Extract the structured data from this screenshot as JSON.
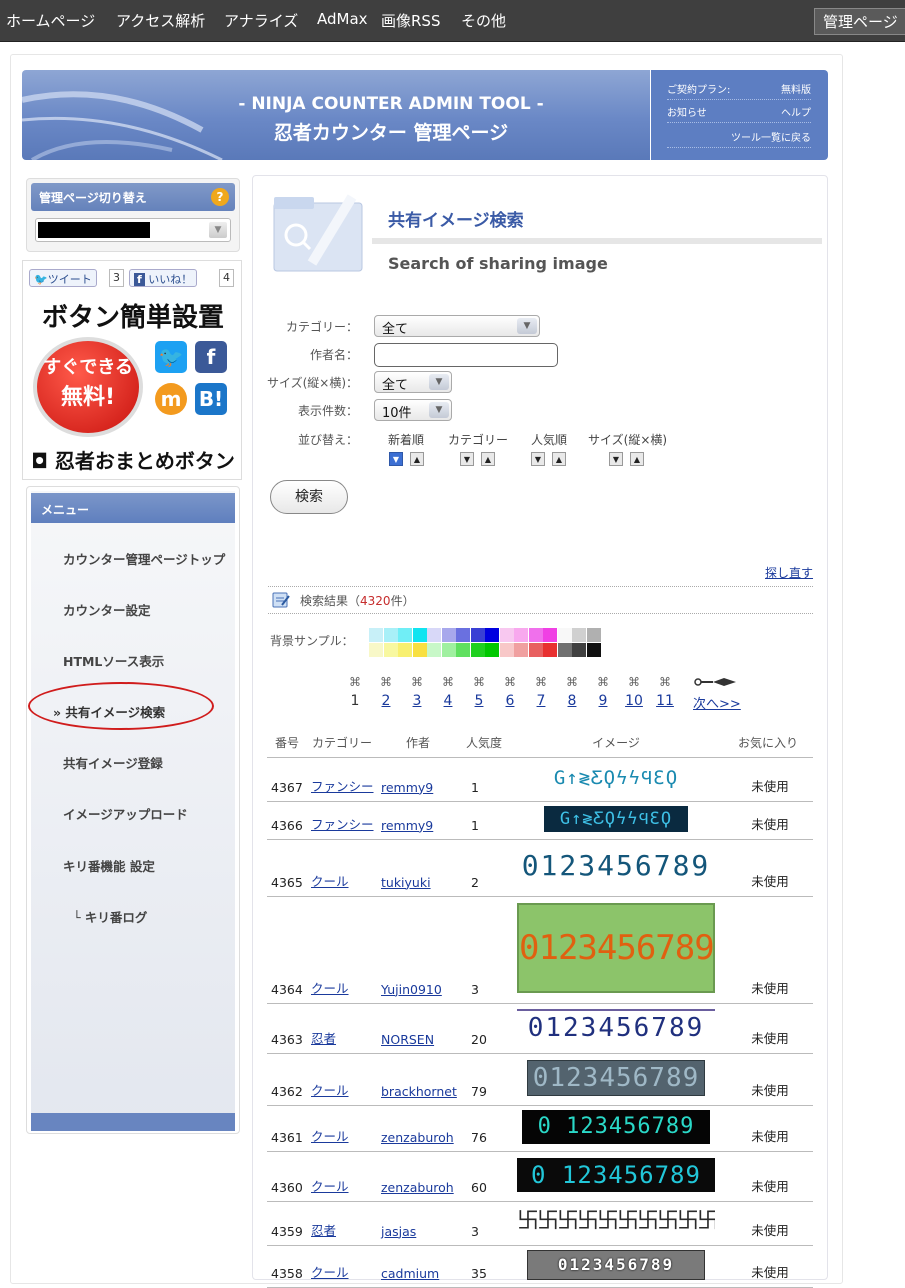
{
  "topnav": {
    "items": [
      "ホームページ",
      "アクセス解析",
      "アナライズ",
      "AdMax",
      "画像RSS",
      "その他"
    ],
    "admin_label": "管理ページ"
  },
  "banner": {
    "line1": "- NINJA COUNTER ADMIN TOOL -",
    "line2": "忍者カウンター 管理ページ"
  },
  "plan": {
    "plan_label": "ご契約プラン:",
    "plan_value": "無料版",
    "notice": "お知らせ",
    "help": "ヘルプ",
    "back": "ツール一覧に戻る"
  },
  "switcher": {
    "title": "管理ページ切り替え",
    "help_glyph": "?"
  },
  "ad": {
    "tweet": "ツイート",
    "tweet_count": "3",
    "like": "いいね！",
    "like_count": "4",
    "headline": "ボタン簡単設置",
    "badge1": "すぐできる",
    "badge2": "無料!",
    "footer": "忍者おまとめボタン"
  },
  "menu": {
    "title": "メニュー",
    "items": [
      "カウンター管理ページトップ",
      "カウンター設定",
      "HTMLソース表示",
      "» 共有イメージ検索",
      "共有イメージ登録",
      "イメージアップロード",
      "キリ番機能 設定",
      "└ キリ番ログ"
    ]
  },
  "page": {
    "title": "共有イメージ検索",
    "subtitle": "Search of sharing image"
  },
  "form": {
    "category_label": "カテゴリー：",
    "category_value": "全て",
    "author_label": "作者名：",
    "author_value": "",
    "size_label": "サイズ(縦×横)：",
    "size_value": "全て",
    "count_label": "表示件数：",
    "count_value": "10件",
    "sort_label": "並び替え：",
    "sort_options": [
      "新着順",
      "カテゴリー",
      "人気順",
      "サイズ(縦×横)"
    ],
    "search_button": "検索"
  },
  "results_header": {
    "retry": "探し直す",
    "prefix": "検索結果（",
    "count": "4320",
    "suffix": "件）",
    "bg_label": "背景サンプル："
  },
  "swatches_top": [
    "#c8f0f8",
    "#a8f0f8",
    "#70eef6",
    "#10e4f0",
    "#d8d8f8",
    "#a8a8ec",
    "#6a70e0",
    "#3a40d4",
    "#0000e0",
    "#f8c8f0",
    "#f8a8ee",
    "#f070ec",
    "#f040e4",
    "#f8f8f8",
    "#d0d0d0",
    "#b0b0b0"
  ],
  "swatches_bottom": [
    "#f8f8c8",
    "#f8f8a0",
    "#f8f070",
    "#f8e040",
    "#c8f8c8",
    "#a0f0a0",
    "#60e060",
    "#20d020",
    "#00c800",
    "#f8c8c8",
    "#f0a0a0",
    "#e86060",
    "#e83030",
    "#707070",
    "#404040",
    "#101010"
  ],
  "pagination": {
    "pages": [
      "1",
      "2",
      "3",
      "4",
      "5",
      "6",
      "7",
      "8",
      "9",
      "10",
      "11"
    ],
    "next": "次へ>>"
  },
  "table": {
    "headers": [
      "番号",
      "カテゴリー",
      "作者",
      "人気度",
      "イメージ",
      "お気に入り"
    ],
    "rows": [
      {
        "no": "4367",
        "category": "ファンシー",
        "author": "remmy9",
        "pop": "1",
        "digits": "G↑≷ƸϘϟϟϤƐϘ",
        "fav": "未使用"
      },
      {
        "no": "4366",
        "category": "ファンシー",
        "author": "remmy9",
        "pop": "1",
        "digits": "G↑≷ƸϘϟϟϤƐϘ",
        "fav": "未使用"
      },
      {
        "no": "4365",
        "category": "クール",
        "author": "tukiyuki",
        "pop": "2",
        "digits": "0123456789",
        "fav": "未使用"
      },
      {
        "no": "4364",
        "category": "クール",
        "author": "Yujin0910",
        "pop": "3",
        "digits": "0123456789",
        "fav": "未使用"
      },
      {
        "no": "4363",
        "category": "忍者",
        "author": "NORSEN",
        "pop": "20",
        "digits": "0123456789",
        "fav": "未使用"
      },
      {
        "no": "4362",
        "category": "クール",
        "author": "brackhornet",
        "pop": "79",
        "digits": "0123456789",
        "fav": "未使用"
      },
      {
        "no": "4361",
        "category": "クール",
        "author": "zenzaburoh",
        "pop": "76",
        "digits": "0 123456789",
        "fav": "未使用"
      },
      {
        "no": "4360",
        "category": "クール",
        "author": "zenzaburoh",
        "pop": "60",
        "digits": "0 123456789",
        "fav": "未使用"
      },
      {
        "no": "4359",
        "category": "忍者",
        "author": "jasjas",
        "pop": "3",
        "digits": "卐卐卐卐卐卐卐卐卐卐",
        "fav": "未使用"
      },
      {
        "no": "4358",
        "category": "クール",
        "author": "cadmium",
        "pop": "35",
        "digits": "0123456789",
        "fav": "未使用"
      }
    ]
  },
  "colors": {
    "topbar": "#3f3f3f",
    "banner": "#6a88c6",
    "accent": "#3a5aa6",
    "link": "#1a3a9c",
    "count_red": "#c62d2d",
    "highlight_oval": "#d01c1c"
  }
}
